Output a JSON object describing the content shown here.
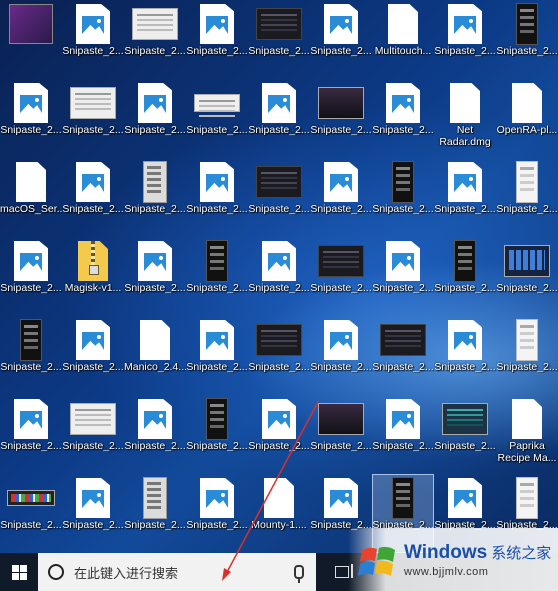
{
  "desktop": {
    "icons": [
      {
        "label": "",
        "kind": "purple"
      },
      {
        "label": "Snipaste_2...",
        "kind": "img"
      },
      {
        "label": "Snipaste_2...",
        "kind": "wide"
      },
      {
        "label": "Snipaste_2...",
        "kind": "img"
      },
      {
        "label": "Snipaste_2...",
        "kind": "wide-dark"
      },
      {
        "label": "Snipaste_2...",
        "kind": "img"
      },
      {
        "label": "Multitouch...",
        "kind": "doc"
      },
      {
        "label": "Snipaste_2...",
        "kind": "img"
      },
      {
        "label": "Snipaste_2...",
        "kind": "phone"
      },
      {
        "label": "Snipaste_2...",
        "kind": "img"
      },
      {
        "label": "Snipaste_2...",
        "kind": "wide"
      },
      {
        "label": "Snipaste_2...",
        "kind": "img"
      },
      {
        "label": "Snipaste_2...",
        "kind": "wide-slim"
      },
      {
        "label": "Snipaste_2...",
        "kind": "img"
      },
      {
        "label": "Snipaste_2...",
        "kind": "wide-video"
      },
      {
        "label": "Snipaste_2...",
        "kind": "img"
      },
      {
        "label": "Net\nRadar.dmg",
        "kind": "doc"
      },
      {
        "label": "OpenRA-pl...",
        "kind": "doc"
      },
      {
        "label": "macOS_Ser...",
        "kind": "doc"
      },
      {
        "label": "Snipaste_2...",
        "kind": "img"
      },
      {
        "label": "Snipaste_2...",
        "kind": "mixed"
      },
      {
        "label": "Snipaste_2...",
        "kind": "img"
      },
      {
        "label": "Snipaste_2...",
        "kind": "wide-dark"
      },
      {
        "label": "Snipaste_2...",
        "kind": "img"
      },
      {
        "label": "Snipaste_2...",
        "kind": "phone"
      },
      {
        "label": "Snipaste_2...",
        "kind": "img"
      },
      {
        "label": "Snipaste_2...",
        "kind": "phone-light"
      },
      {
        "label": "Snipaste_2...",
        "kind": "img"
      },
      {
        "label": "Magisk-v1...",
        "kind": "zip"
      },
      {
        "label": "Snipaste_2...",
        "kind": "img"
      },
      {
        "label": "Snipaste_2...",
        "kind": "phone"
      },
      {
        "label": "Snipaste_2...",
        "kind": "img"
      },
      {
        "label": "Snipaste_2...",
        "kind": "wide-dark"
      },
      {
        "label": "Snipaste_2...",
        "kind": "img"
      },
      {
        "label": "Snipaste_2...",
        "kind": "phone"
      },
      {
        "label": "Snipaste_2...",
        "kind": "wide-tiles"
      },
      {
        "label": "Snipaste_2...",
        "kind": "phone"
      },
      {
        "label": "Snipaste_2...",
        "kind": "img"
      },
      {
        "label": "Manico_2.4...",
        "kind": "doc"
      },
      {
        "label": "Snipaste_2...",
        "kind": "img"
      },
      {
        "label": "Snipaste_2...",
        "kind": "wide-dark"
      },
      {
        "label": "Snipaste_2...",
        "kind": "img"
      },
      {
        "label": "Snipaste_2...",
        "kind": "wide-dark"
      },
      {
        "label": "Snipaste_2...",
        "kind": "img"
      },
      {
        "label": "Snipaste_2...",
        "kind": "phone-light"
      },
      {
        "label": "Snipaste_2...",
        "kind": "img"
      },
      {
        "label": "Snipaste_2...",
        "kind": "wide"
      },
      {
        "label": "Snipaste_2...",
        "kind": "img"
      },
      {
        "label": "Snipaste_2...",
        "kind": "phone"
      },
      {
        "label": "Snipaste_2...",
        "kind": "img"
      },
      {
        "label": "Snipaste_2...",
        "kind": "wide-video"
      },
      {
        "label": "Snipaste_2...",
        "kind": "img"
      },
      {
        "label": "Snipaste_2...",
        "kind": "wide-teal"
      },
      {
        "label": "Paprika\nRecipe Ma...",
        "kind": "doc"
      },
      {
        "label": "Snipaste_2...",
        "kind": "wide-strip"
      },
      {
        "label": "Snipaste_2...",
        "kind": "img"
      },
      {
        "label": "Snipaste_2...",
        "kind": "mixed"
      },
      {
        "label": "Snipaste_2...",
        "kind": "img"
      },
      {
        "label": "Mounty-1....",
        "kind": "doc"
      },
      {
        "label": "Snipaste_2...",
        "kind": "img"
      },
      {
        "label": "Snipaste_2...",
        "kind": "phone",
        "selected": true
      },
      {
        "label": "Snipaste_2...",
        "kind": "img"
      },
      {
        "label": "Snipaste_2...",
        "kind": "phone-light"
      }
    ]
  },
  "taskbar": {
    "search_placeholder": "在此键入进行搜索"
  },
  "watermark": {
    "brand": "Windows",
    "brand_cn": "系统之家",
    "url": "www.bjjmlv.com"
  }
}
